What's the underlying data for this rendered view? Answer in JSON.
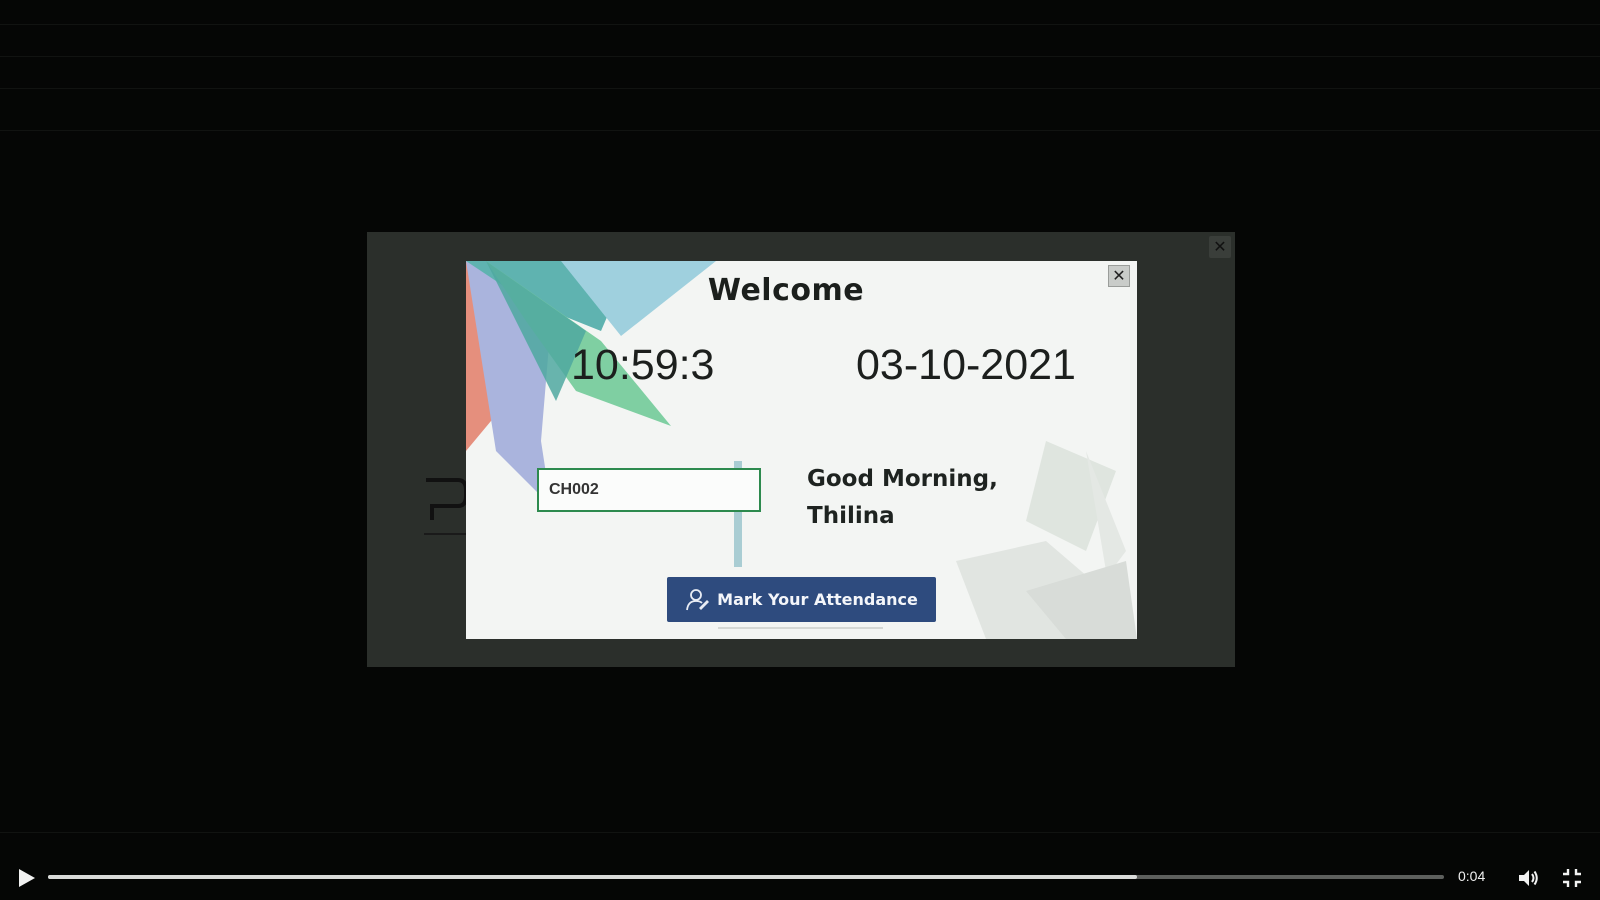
{
  "dialog": {
    "title": "Welcome",
    "time": "10:59:3",
    "date": "03-10-2021",
    "employee_id_value": "CH002",
    "greeting_line1": "Good Morning,",
    "greeting_line2": "Thilina",
    "button_label": "Mark Your Attendance",
    "close_glyph": "✕"
  },
  "outer_modal": {
    "close_glyph": "✕"
  },
  "video": {
    "current_time": "0:04",
    "progress_fraction": 0.78
  },
  "colors": {
    "button": "#2e4b7e",
    "input_border": "#2d8a4e",
    "dialog_bg": "#f3f5f3",
    "outer_modal_bg": "#2b2f2b"
  },
  "icons": {
    "play": "play-icon",
    "volume": "volume-icon",
    "fullscreen": "exit-fullscreen-icon",
    "attendance": "user-check-icon",
    "close": "close-icon"
  }
}
